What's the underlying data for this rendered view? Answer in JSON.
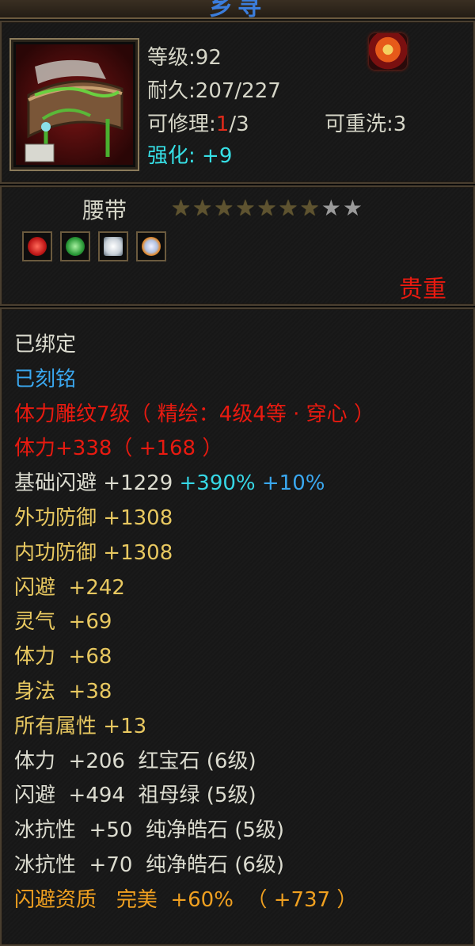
{
  "header": {
    "title": "乡寻",
    "level_label": "等级",
    "level_value": "92",
    "durability_label": "耐久",
    "durability_value": "207/227",
    "repair_label": "可修理",
    "repair_current": "1",
    "repair_max": "/3",
    "rewash_label": "可重洗",
    "rewash_value": "3",
    "enhance_label": "强化",
    "enhance_value": "+9"
  },
  "item": {
    "type": "腰带",
    "stars_filled": 7,
    "stars_total": 9,
    "quality": "贵重",
    "gems": [
      {
        "name": "red-gem",
        "color": "#c01818"
      },
      {
        "name": "green-gem",
        "color": "#2a9a38"
      },
      {
        "name": "white-gem",
        "color": "#c8d0d8"
      },
      {
        "name": "orange-gem",
        "color": "#e08a30"
      }
    ]
  },
  "attributes": {
    "bound": "已绑定",
    "engraved": "已刻铭",
    "carving": "体力雕纹7级（ 精绘：4级4等 · 穿心 ）",
    "stamina_main": "体力+338（ +168 ）",
    "base_dodge_label": "基础闪避",
    "base_dodge_value": "+1229",
    "base_dodge_pct1": "+390%",
    "base_dodge_pct2": "+10%",
    "ext_def_label": "外功防御",
    "ext_def_value": "+1308",
    "int_def_label": "内功防御",
    "int_def_value": "+1308",
    "dodge_label": "闪避",
    "dodge_value": "+242",
    "spirit_label": "灵气",
    "spirit_value": "+69",
    "stamina_label": "体力",
    "stamina_value": "+68",
    "agility_label": "身法",
    "agility_value": "+38",
    "all_label": "所有属性",
    "all_value": "+13",
    "gem1_stat": "体力",
    "gem1_value": "+206",
    "gem1_name": "红宝石 (6级)",
    "gem2_stat": "闪避",
    "gem2_value": "+494",
    "gem2_name": "祖母绿 (5级)",
    "gem3_stat": "冰抗性",
    "gem3_value": "+50",
    "gem3_name": "纯净皓石 (5级)",
    "gem4_stat": "冰抗性",
    "gem4_value": "+70",
    "gem4_name": "纯净皓石 (6级)",
    "aptitude_label": "闪避资质",
    "aptitude_grade": "完美",
    "aptitude_value": "+60%",
    "aptitude_bonus": "（ +737 ）"
  },
  "colors": {
    "red": "#e81a10",
    "yellow": "#e8c860",
    "cyan": "#36d8e6",
    "orange": "#f0a020",
    "blue": "#3aa8f0"
  }
}
